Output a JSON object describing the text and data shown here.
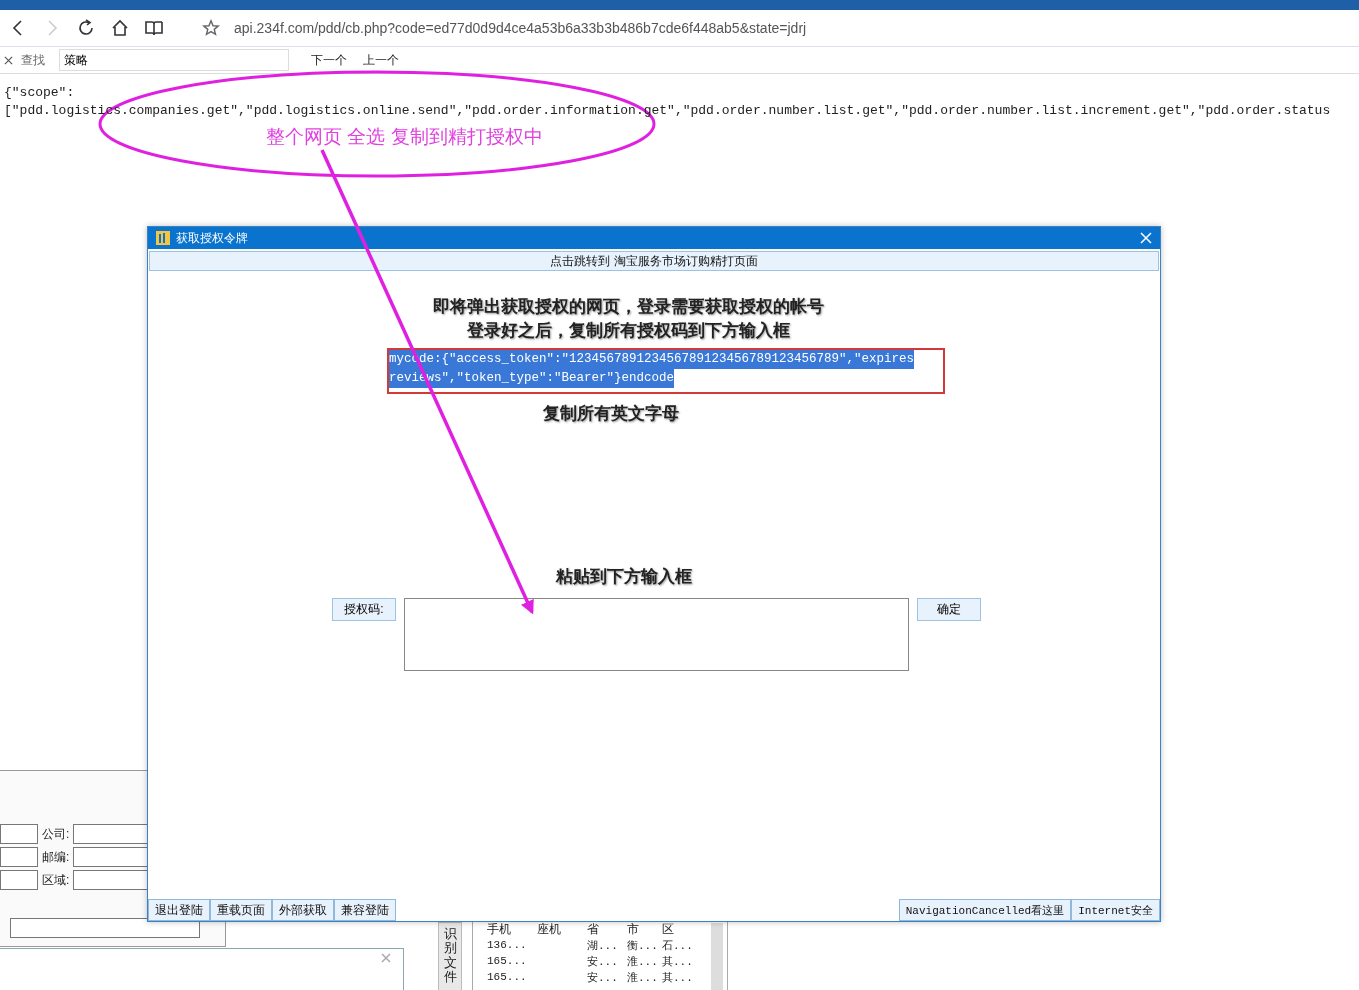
{
  "browser": {
    "forward_disabled": true,
    "url": "api.234f.com/pdd/cb.php?code=ed77d0d9d4ce4a53b6a33b3b486b7cde6f448ab5&state=jdrj",
    "find_bar": {
      "label": "查找",
      "value": "策略",
      "next": "下一个",
      "previous": "上一个"
    }
  },
  "page_text": [
    "{\"scope\":",
    "[\"pdd.logistics.companies.get\",\"pdd.logistics.online.send\",\"pdd.order.information.get\",\"pdd.order.number.list.get\",\"pdd.order.number.list.increment.get\",\"pdd.order.status"
  ],
  "background_app": {
    "form": [
      {
        "label": "公司:"
      },
      {
        "label": "邮编:"
      },
      {
        "label": "区域:"
      }
    ],
    "side_tab": "识别文件",
    "table": {
      "columns": [
        "手机",
        "座机",
        "省",
        "市",
        "区"
      ],
      "rows": [
        [
          "136...",
          "",
          "湖...",
          "衡...",
          "石..."
        ],
        [
          "165...",
          "",
          "安...",
          "淮...",
          "其..."
        ],
        [
          "165...",
          "",
          "安...",
          "淮...",
          "其..."
        ]
      ]
    }
  },
  "dialog": {
    "title": "获取授权令牌",
    "top_button": "点击跳转到 淘宝服务市场订购精打页面",
    "instructions": [
      "即将弹出获取授权的网页，登录需要获取授权的帐号",
      "登录好之后，复制所有授权码到下方输入框"
    ],
    "code_lines": [
      "mycode:{\"access_token\":\"123456789123456789123456789123456789\",\"expires",
      "reviews\",\"token_type\":\"Bearer\"}endcode"
    ],
    "code_hint": "复制所有英文字母",
    "paste_hint": "粘贴到下方输入框",
    "code_label": "授权码:",
    "confirm": "确定",
    "bottom_left_buttons": [
      "退出登陆",
      "重载页面",
      "外部获取",
      "兼容登陆"
    ],
    "bottom_right_buttons": [
      "NavigationCancelled看这里",
      "Internet安全"
    ]
  },
  "annotation": {
    "text": "整个网页 全选 复制到精打授权中"
  }
}
